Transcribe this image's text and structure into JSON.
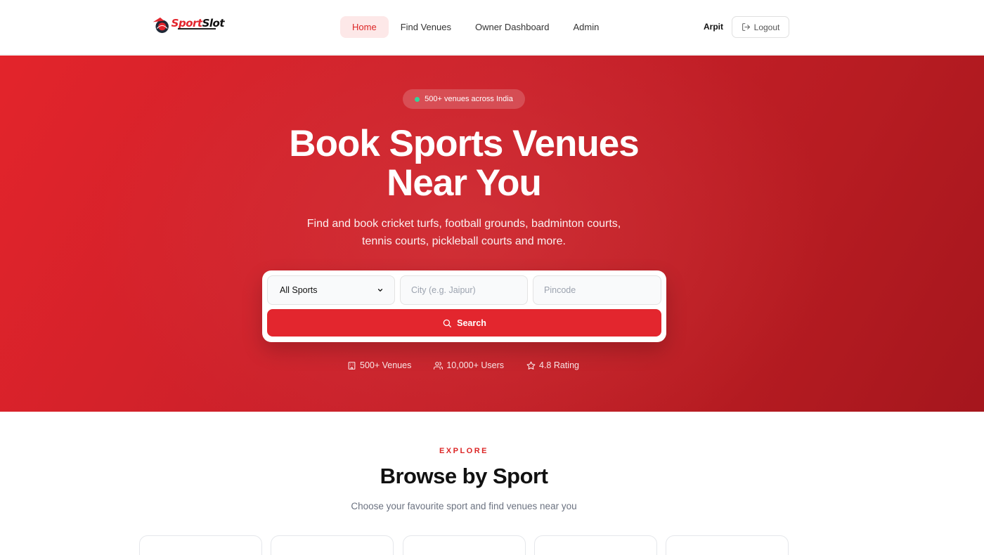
{
  "navbar": {
    "brand": "SportSlot",
    "links": [
      "Home",
      "Find Venues",
      "Owner Dashboard",
      "Admin"
    ],
    "active": "Home",
    "user_name": "Arpit",
    "logout_label": "Logout"
  },
  "hero": {
    "badge": "500+ venues across India",
    "title_line1": "Book Sports Venues",
    "title_line2": "Near You",
    "subtitle": "Find and book cricket turfs, football grounds, badminton courts, tennis courts, pickleball courts and more.",
    "search": {
      "sport_select_value": "All Sports",
      "city_placeholder": "City (e.g. Jaipur)",
      "pincode_placeholder": "Pincode",
      "button_label": "Search"
    },
    "stats": [
      {
        "icon": "building-icon",
        "label": "500+ Venues"
      },
      {
        "icon": "users-icon",
        "label": "10,000+ Users"
      },
      {
        "icon": "star-icon",
        "label": "4.8 Rating"
      }
    ]
  },
  "browse": {
    "eyebrow": "EXPLORE",
    "title": "Browse by Sport",
    "subtitle": "Choose your favourite sport and find venues near you"
  },
  "colors": {
    "brand_red": "#e3262e",
    "online_dot": "#34d399"
  }
}
